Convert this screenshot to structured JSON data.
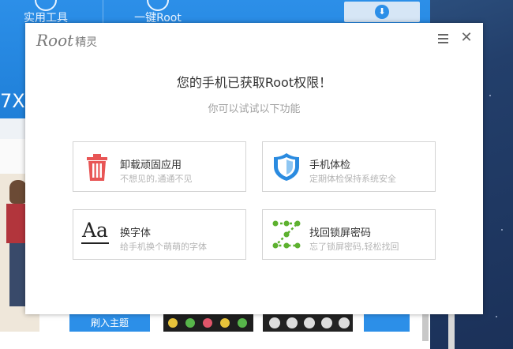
{
  "background_app": {
    "tab_tools": "实用工具",
    "tab_one_key_root": "一键Root",
    "big_text": "7X",
    "apply_theme_button": "刷入主题"
  },
  "dialog": {
    "logo_root": "Root",
    "logo_cn": "精灵",
    "title": "您的手机已获取Root权限！",
    "subtitle": "你可以试试以下功能",
    "menu_icon": "hamburger-menu-icon",
    "close_icon": "close-icon",
    "cards": [
      {
        "name": "卸载顽固应用",
        "desc": "不想见的,通通不见",
        "icon": "trash-icon",
        "icon_color": "#e85555"
      },
      {
        "name": "手机体检",
        "desc": "定期体检保持系统安全",
        "icon": "shield-icon",
        "icon_color": "#2a8be0"
      },
      {
        "name": "换字体",
        "desc": "给手机换个萌萌的字体",
        "icon": "font-icon",
        "icon_text": "Aa",
        "icon_color": "#222222"
      },
      {
        "name": "找回锁屏密码",
        "desc": "忘了锁屏密码,轻松找回",
        "icon": "pattern-lock-icon",
        "icon_color": "#5db12f"
      }
    ]
  },
  "colors": {
    "accent_blue": "#2c8fe8",
    "trash_red": "#e85555",
    "shield_blue": "#2a8be0",
    "pattern_green": "#5db12f"
  }
}
